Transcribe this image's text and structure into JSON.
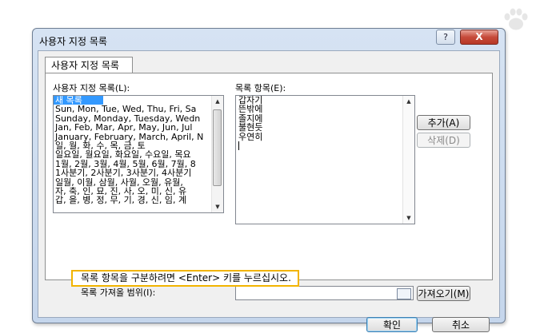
{
  "dialog": {
    "title": "사용자 지정 목록",
    "help_label": "?",
    "close_label": "X",
    "tab_label": "사용자 지정 목록"
  },
  "custom_lists": {
    "label": "사용자 지정 목록(L):",
    "items": [
      "새 목록",
      "Sun, Mon, Tue, Wed, Thu, Fri, Sa",
      "Sunday, Monday, Tuesday, Wedn",
      "Jan, Feb, Mar, Apr, May, Jun, Jul",
      "January, February, March, April, N",
      "일, 월, 화, 수, 목, 금, 토",
      "일요일, 월요일, 화요일, 수요일, 목요",
      "1월, 2월, 3월, 4월, 5월, 6월, 7월, 8",
      "1사분기, 2사분기, 3사분기, 4사분기",
      "일월, 이월, 삼월, 사월, 오월, 유월,",
      "자, 축, 인, 묘, 진, 사, 오, 미, 신, 유",
      "갑, 을, 병, 정, 무, 기, 경, 신, 임, 계"
    ]
  },
  "list_entries": {
    "label": "목록 항목(E):",
    "lines": [
      "갑자기",
      "뜬밖에",
      "졸지에",
      "불현듯",
      "우연히"
    ]
  },
  "buttons": {
    "add": "추가(A)",
    "delete": "삭제(D)",
    "import": "가져오기(M)",
    "ok": "확인",
    "cancel": "취소"
  },
  "import": {
    "label": "목록 가져올 범위(I):",
    "value": ""
  },
  "tooltip": {
    "text": "목록 항목을 구분하려면 <Enter> 키를 누르십시오."
  }
}
